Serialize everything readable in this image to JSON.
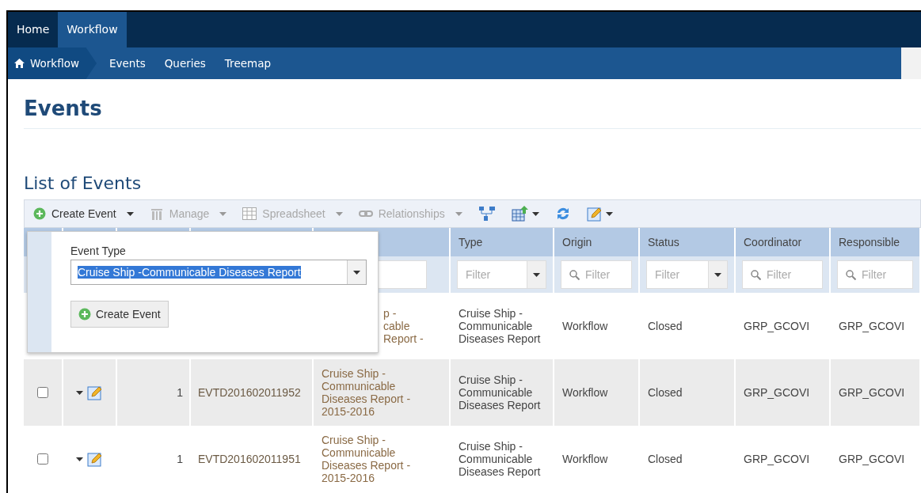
{
  "top_nav": [
    {
      "label": "Home",
      "selected": false
    },
    {
      "label": "Workflow",
      "selected": true
    }
  ],
  "breadcrumb": {
    "label": "Workflow"
  },
  "sub_nav": [
    "Events",
    "Queries",
    "Treemap"
  ],
  "page_title": "Events",
  "section_title": "List of Events",
  "toolbar": [
    {
      "label": "Create Event",
      "disabled": false
    },
    {
      "label": "Manage",
      "disabled": true
    },
    {
      "label": "Spreadsheet",
      "disabled": true
    },
    {
      "label": "Relationships",
      "disabled": true
    }
  ],
  "popup": {
    "field_label": "Event Type",
    "value": "Cruise Ship -Communicable Diseases Report",
    "button": "Create Event"
  },
  "table": {
    "columns": [
      {
        "label": "Type",
        "filter": "Filter",
        "kind": "dropdown"
      },
      {
        "label": "Origin",
        "filter": "Filter",
        "kind": "search"
      },
      {
        "label": "Status",
        "filter": "Filter",
        "kind": "dropdown"
      },
      {
        "label": "Coordinator",
        "filter": "Filter",
        "kind": "search"
      },
      {
        "label": "Responsible",
        "filter": "Filter",
        "kind": "search"
      }
    ],
    "rows": [
      {
        "name": [
          "p -",
          "cable",
          "Report -"
        ],
        "type": "Cruise Ship - Communicable Diseases Report",
        "origin": "Workflow",
        "status": "Closed",
        "coordinator": "GRP_GCOVI",
        "responsible": "GRP_GCOVI"
      },
      {
        "checked": false,
        "count": "1",
        "id": "EVTD201602011952",
        "name": [
          "Cruise Ship - Communicable Diseases Report - 2015-2016"
        ],
        "type": "Cruise Ship - Communicable Diseases Report",
        "origin": "Workflow",
        "status": "Closed",
        "coordinator": "GRP_GCOVI",
        "responsible": "GRP_GCOVI"
      },
      {
        "checked": false,
        "count": "1",
        "id": "EVTD201602011951",
        "name": [
          "Cruise Ship - Communicable Diseases Report - 2015-2016"
        ],
        "type": "Cruise Ship - Communicable Diseases Report",
        "origin": "Workflow",
        "status": "Closed",
        "coordinator": "GRP_GCOVI",
        "responsible": "GRP_GCOVI"
      }
    ]
  }
}
